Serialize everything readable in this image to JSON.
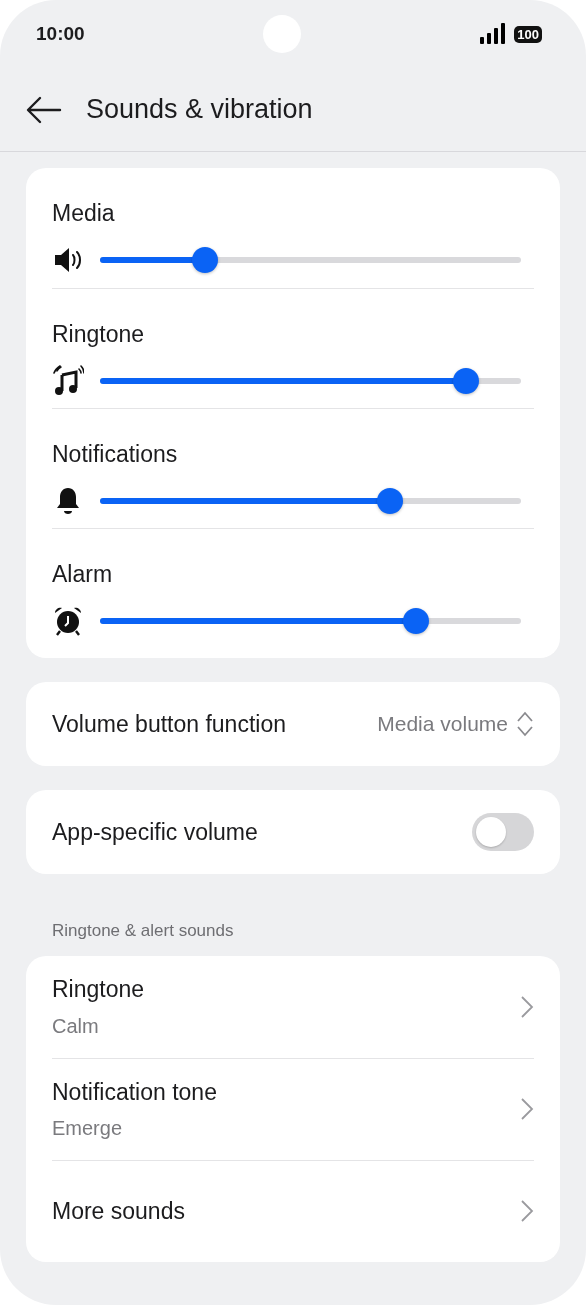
{
  "status_bar": {
    "time": "10:00",
    "battery": "100"
  },
  "header": {
    "title": "Sounds & vibration"
  },
  "volumes": [
    {
      "label": "Media",
      "level": 0.25
    },
    {
      "label": "Ringtone",
      "level": 0.87
    },
    {
      "label": "Notifications",
      "level": 0.69
    },
    {
      "label": "Alarm",
      "level": 0.75
    }
  ],
  "volume_button_function": {
    "label": "Volume button function",
    "value": "Media volume"
  },
  "app_specific_volume": {
    "label": "App-specific volume",
    "on": false
  },
  "section_title": "Ringtone & alert sounds",
  "sound_items": [
    {
      "title": "Ringtone",
      "subtitle": "Calm"
    },
    {
      "title": "Notification tone",
      "subtitle": "Emerge"
    },
    {
      "title": "More sounds"
    }
  ]
}
